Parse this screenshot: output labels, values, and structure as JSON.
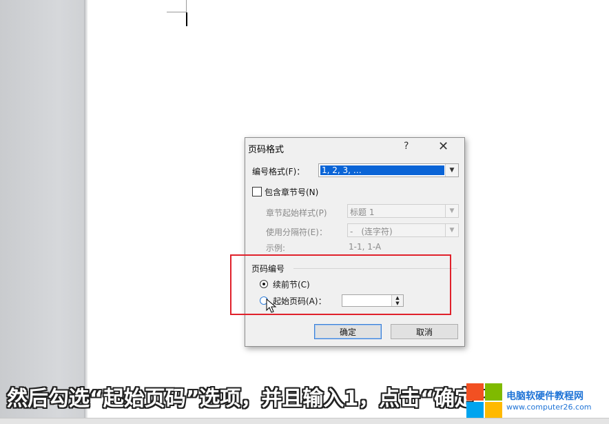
{
  "dialog": {
    "title": "页码格式",
    "help": "?",
    "close": "✕",
    "number_format_label": "编号格式(F)：",
    "number_format_value": "1, 2, 3, …",
    "include_chapter_label": "包含章节号(N)",
    "chapter_style_label": "章节起始样式(P)",
    "chapter_style_value": "标题 1",
    "separator_label": "使用分隔符(E)：",
    "separator_value": "-　(连字符)",
    "example_label": "示例:",
    "example_value": "1-1, 1-A",
    "page_numbering_group": "页码编号",
    "continue_label": "续前节(C)",
    "start_at_label": "起始页码(A)：",
    "start_at_value": "",
    "ok": "确定",
    "cancel": "取消"
  },
  "caption": "然后勾选“起始页码”选项，并且输入1，点击“确定”",
  "watermark": {
    "name": "电脑软硬件教程网",
    "url": "www.computer26.com"
  },
  "colors": {
    "highlight": "#e0202a",
    "selection": "#0a64d6",
    "watermark": "#1e73d6"
  }
}
